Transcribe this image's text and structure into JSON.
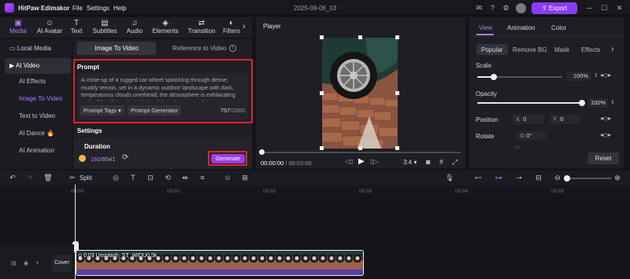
{
  "app": {
    "title": "HitPaw Edimakor",
    "menu": [
      "File",
      "Settings",
      "Help"
    ],
    "project_name": "2025-09-06_03",
    "export_label": "Export"
  },
  "toolbar_tabs": [
    {
      "label": "Media",
      "icon": "media-icon"
    },
    {
      "label": "AI Avatar",
      "icon": "avatar-icon"
    },
    {
      "label": "Text",
      "icon": "text-icon"
    },
    {
      "label": "Subtitles",
      "icon": "subtitles-icon"
    },
    {
      "label": "Audio",
      "icon": "audio-icon"
    },
    {
      "label": "Elements",
      "icon": "elements-icon"
    },
    {
      "label": "Transition",
      "icon": "transition-icon"
    },
    {
      "label": "Filters",
      "icon": "filters-icon"
    }
  ],
  "sidebar": {
    "items": [
      {
        "label": "Local Media",
        "icon": "folder-icon"
      },
      {
        "label": "AI Video",
        "icon": "ai-video-icon"
      },
      {
        "label": "AI Effects"
      },
      {
        "label": "Image To Video"
      },
      {
        "label": "Text to Video"
      },
      {
        "label": "AI Dance 🔥"
      },
      {
        "label": "AI Animation"
      }
    ]
  },
  "generator": {
    "mode_tabs": [
      "Image To Video",
      "Reference to Video"
    ],
    "prompt_heading": "Prompt",
    "prompt_text": "A close-up of a rugged car wheel splashing through dense, muddy terrain, set in a dynamic outdoor landscape with dark, tempestuous clouds overhead; the atmosphere is exhilarating and wild, with a color palette of deep browns and greys.",
    "prompt_tags_label": "Prompt Tags",
    "prompt_generator_label": "Prompt Generator",
    "char_count": "757",
    "char_limit": "/2000",
    "settings_heading": "Settings",
    "duration_label": "Duration",
    "credits_used": "160",
    "credits_total": "/9541",
    "generate_label": "Generate"
  },
  "player": {
    "title": "Player",
    "current_time": "00:00:00",
    "total_time": "/ 00:03:00",
    "aspect": "3:4",
    "progress": 0
  },
  "properties": {
    "tabs": [
      "View",
      "Animation",
      "Color"
    ],
    "subtabs": [
      "Popular",
      "Remove BG",
      "Mask",
      "Effects"
    ],
    "scale_label": "Scale",
    "scale_value": "100%",
    "scale_level": 1.0,
    "opacity_label": "Opacity",
    "opacity_value": "100%",
    "opacity_level": 1.0,
    "position_label": "Position",
    "pos_x_label": "X",
    "pos_x": "0",
    "pos_y_label": "Y",
    "pos_y": "0",
    "rotate_label": "Rotate",
    "rotate_value": "0°",
    "reset_label": "Reset"
  },
  "timeline_toolbar": {
    "split_label": "Split"
  },
  "timeline": {
    "ruler_ticks": [
      "00:00",
      "00:01",
      "00:02",
      "00:03",
      "00:04",
      "00:05"
    ],
    "cover_label": "Cover",
    "clip_label": "0:03 Unsplash_ST_WIDU0.5k"
  },
  "colors": {
    "accent": "#8b3cf7",
    "highlight_red": "#e0222f",
    "panel_bg": "#1e1e23"
  }
}
